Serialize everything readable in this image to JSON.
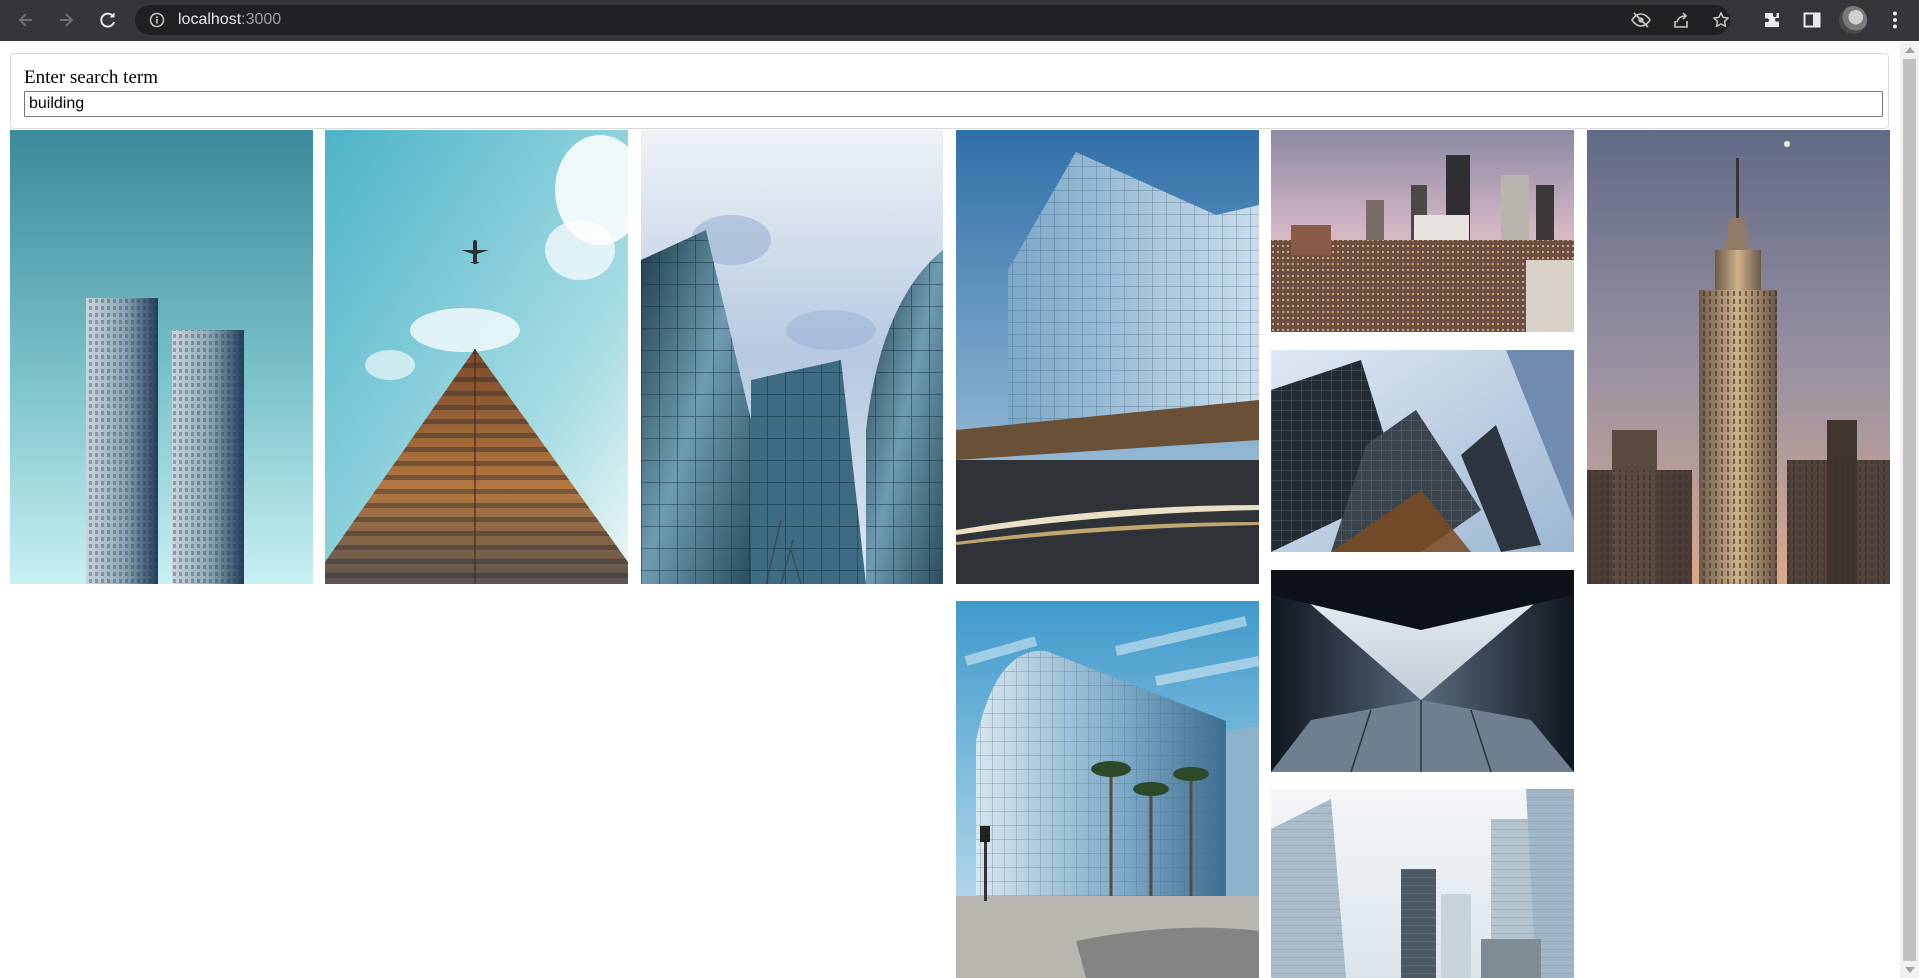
{
  "browser": {
    "url_host": "localhost",
    "url_port": ":3000",
    "icons": [
      "back-icon",
      "forward-icon",
      "reload-icon",
      "site-info-icon",
      "eye-slash-icon",
      "share-icon",
      "star-icon",
      "extensions-icon",
      "side-panel-icon",
      "avatar",
      "menu-icon"
    ]
  },
  "search": {
    "label": "Enter search term",
    "value": "building"
  },
  "gallery": {
    "query": "building",
    "images": [
      "twin-towers-teal-sky",
      "airplane-over-skyscraper",
      "curved-glass-buildings",
      "glass-building-light-trails",
      "city-skyline-dusk",
      "skyscrapers-looking-up",
      "geometric-glass-facade",
      "empire-state-building",
      "glass-office-palm-trees",
      "white-skyscrapers-looking-up"
    ]
  },
  "colors": {
    "chrome_bg": "#35363a",
    "omnibox_bg": "#202124",
    "page_bg": "#ffffff"
  }
}
